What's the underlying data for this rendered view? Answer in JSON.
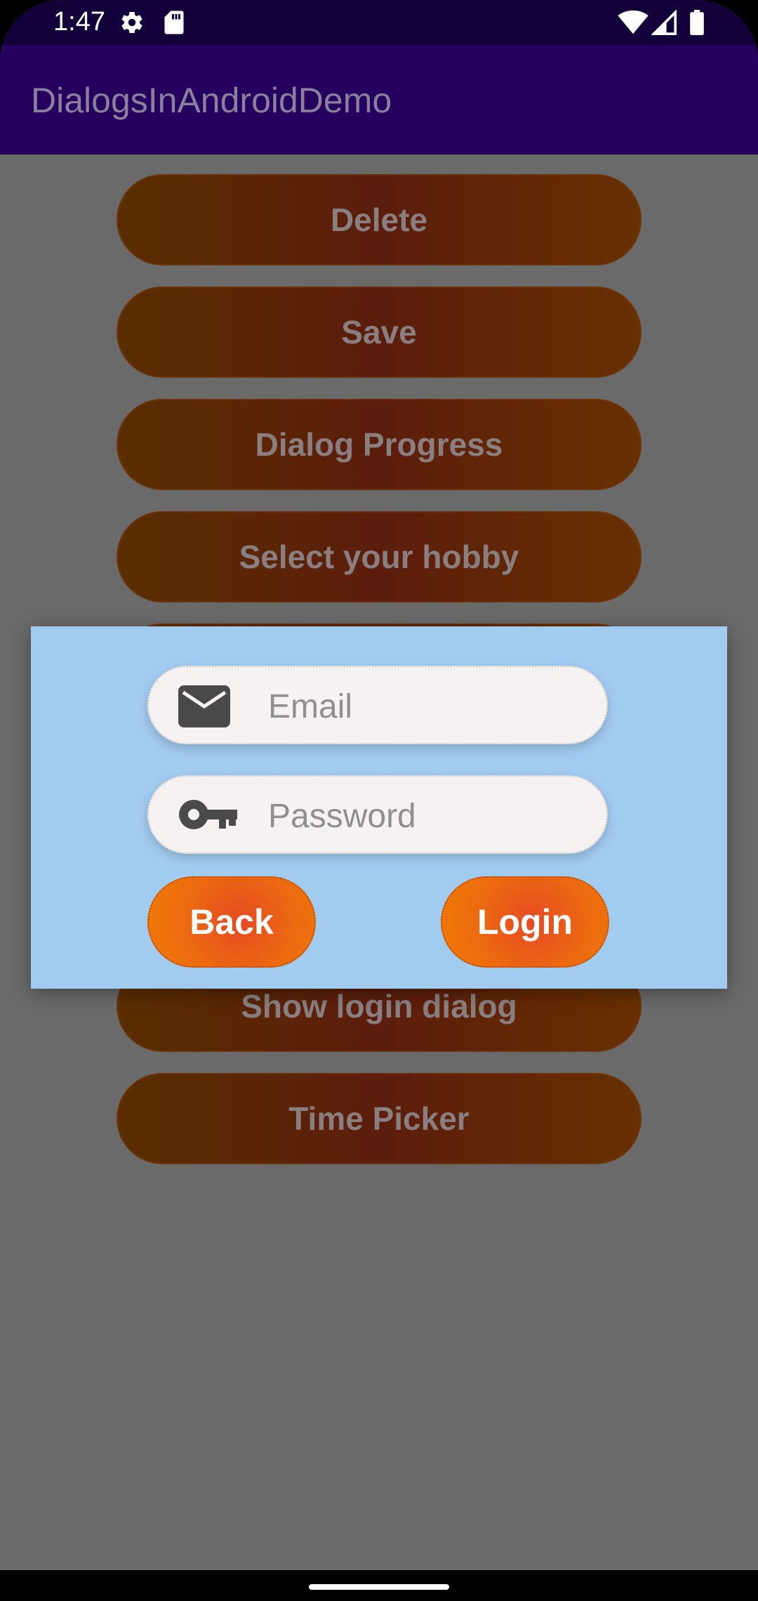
{
  "status_bar": {
    "time": "1:47",
    "icons": [
      "gear-icon",
      "sd-card-icon",
      "wifi-icon",
      "signal-icon",
      "battery-icon"
    ]
  },
  "app_bar": {
    "title": "DialogsInAndroidDemo"
  },
  "background_buttons": [
    "Delete",
    "Save",
    "Dialog Progress",
    "Select your hobby",
    "Show login dialog",
    "Time Picker"
  ],
  "dialog": {
    "email": {
      "placeholder": "Email",
      "value": ""
    },
    "password": {
      "placeholder": "Password",
      "value": ""
    },
    "back_label": "Back",
    "login_label": "Login"
  },
  "colors": {
    "app_bar": "#26005e",
    "status_bar": "#12003a",
    "dialog_bg": "#a2cbf0",
    "button_orange": "#ec6a10"
  }
}
